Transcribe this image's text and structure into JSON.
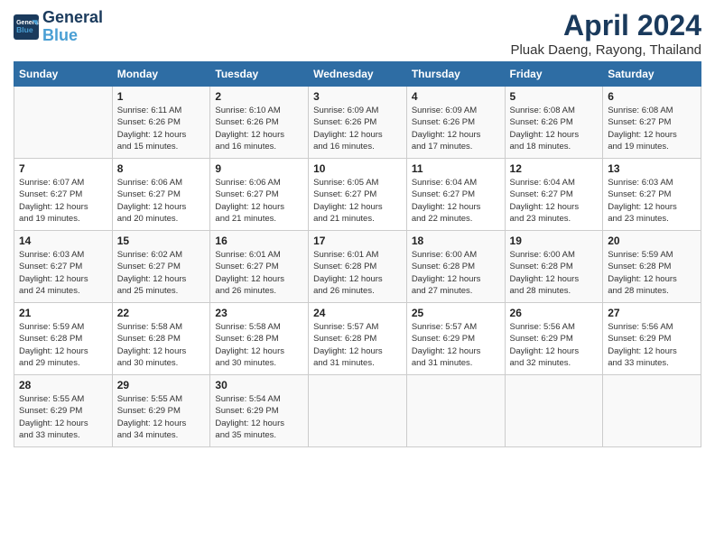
{
  "header": {
    "logo_line1": "General",
    "logo_line2": "Blue",
    "month": "April 2024",
    "location": "Pluak Daeng, Rayong, Thailand"
  },
  "days_of_week": [
    "Sunday",
    "Monday",
    "Tuesday",
    "Wednesday",
    "Thursday",
    "Friday",
    "Saturday"
  ],
  "weeks": [
    [
      {
        "day": "",
        "info": ""
      },
      {
        "day": "1",
        "info": "Sunrise: 6:11 AM\nSunset: 6:26 PM\nDaylight: 12 hours\nand 15 minutes."
      },
      {
        "day": "2",
        "info": "Sunrise: 6:10 AM\nSunset: 6:26 PM\nDaylight: 12 hours\nand 16 minutes."
      },
      {
        "day": "3",
        "info": "Sunrise: 6:09 AM\nSunset: 6:26 PM\nDaylight: 12 hours\nand 16 minutes."
      },
      {
        "day": "4",
        "info": "Sunrise: 6:09 AM\nSunset: 6:26 PM\nDaylight: 12 hours\nand 17 minutes."
      },
      {
        "day": "5",
        "info": "Sunrise: 6:08 AM\nSunset: 6:26 PM\nDaylight: 12 hours\nand 18 minutes."
      },
      {
        "day": "6",
        "info": "Sunrise: 6:08 AM\nSunset: 6:27 PM\nDaylight: 12 hours\nand 19 minutes."
      }
    ],
    [
      {
        "day": "7",
        "info": "Sunrise: 6:07 AM\nSunset: 6:27 PM\nDaylight: 12 hours\nand 19 minutes."
      },
      {
        "day": "8",
        "info": "Sunrise: 6:06 AM\nSunset: 6:27 PM\nDaylight: 12 hours\nand 20 minutes."
      },
      {
        "day": "9",
        "info": "Sunrise: 6:06 AM\nSunset: 6:27 PM\nDaylight: 12 hours\nand 21 minutes."
      },
      {
        "day": "10",
        "info": "Sunrise: 6:05 AM\nSunset: 6:27 PM\nDaylight: 12 hours\nand 21 minutes."
      },
      {
        "day": "11",
        "info": "Sunrise: 6:04 AM\nSunset: 6:27 PM\nDaylight: 12 hours\nand 22 minutes."
      },
      {
        "day": "12",
        "info": "Sunrise: 6:04 AM\nSunset: 6:27 PM\nDaylight: 12 hours\nand 23 minutes."
      },
      {
        "day": "13",
        "info": "Sunrise: 6:03 AM\nSunset: 6:27 PM\nDaylight: 12 hours\nand 23 minutes."
      }
    ],
    [
      {
        "day": "14",
        "info": "Sunrise: 6:03 AM\nSunset: 6:27 PM\nDaylight: 12 hours\nand 24 minutes."
      },
      {
        "day": "15",
        "info": "Sunrise: 6:02 AM\nSunset: 6:27 PM\nDaylight: 12 hours\nand 25 minutes."
      },
      {
        "day": "16",
        "info": "Sunrise: 6:01 AM\nSunset: 6:27 PM\nDaylight: 12 hours\nand 26 minutes."
      },
      {
        "day": "17",
        "info": "Sunrise: 6:01 AM\nSunset: 6:28 PM\nDaylight: 12 hours\nand 26 minutes."
      },
      {
        "day": "18",
        "info": "Sunrise: 6:00 AM\nSunset: 6:28 PM\nDaylight: 12 hours\nand 27 minutes."
      },
      {
        "day": "19",
        "info": "Sunrise: 6:00 AM\nSunset: 6:28 PM\nDaylight: 12 hours\nand 28 minutes."
      },
      {
        "day": "20",
        "info": "Sunrise: 5:59 AM\nSunset: 6:28 PM\nDaylight: 12 hours\nand 28 minutes."
      }
    ],
    [
      {
        "day": "21",
        "info": "Sunrise: 5:59 AM\nSunset: 6:28 PM\nDaylight: 12 hours\nand 29 minutes."
      },
      {
        "day": "22",
        "info": "Sunrise: 5:58 AM\nSunset: 6:28 PM\nDaylight: 12 hours\nand 30 minutes."
      },
      {
        "day": "23",
        "info": "Sunrise: 5:58 AM\nSunset: 6:28 PM\nDaylight: 12 hours\nand 30 minutes."
      },
      {
        "day": "24",
        "info": "Sunrise: 5:57 AM\nSunset: 6:28 PM\nDaylight: 12 hours\nand 31 minutes."
      },
      {
        "day": "25",
        "info": "Sunrise: 5:57 AM\nSunset: 6:29 PM\nDaylight: 12 hours\nand 31 minutes."
      },
      {
        "day": "26",
        "info": "Sunrise: 5:56 AM\nSunset: 6:29 PM\nDaylight: 12 hours\nand 32 minutes."
      },
      {
        "day": "27",
        "info": "Sunrise: 5:56 AM\nSunset: 6:29 PM\nDaylight: 12 hours\nand 33 minutes."
      }
    ],
    [
      {
        "day": "28",
        "info": "Sunrise: 5:55 AM\nSunset: 6:29 PM\nDaylight: 12 hours\nand 33 minutes."
      },
      {
        "day": "29",
        "info": "Sunrise: 5:55 AM\nSunset: 6:29 PM\nDaylight: 12 hours\nand 34 minutes."
      },
      {
        "day": "30",
        "info": "Sunrise: 5:54 AM\nSunset: 6:29 PM\nDaylight: 12 hours\nand 35 minutes."
      },
      {
        "day": "",
        "info": ""
      },
      {
        "day": "",
        "info": ""
      },
      {
        "day": "",
        "info": ""
      },
      {
        "day": "",
        "info": ""
      }
    ]
  ]
}
